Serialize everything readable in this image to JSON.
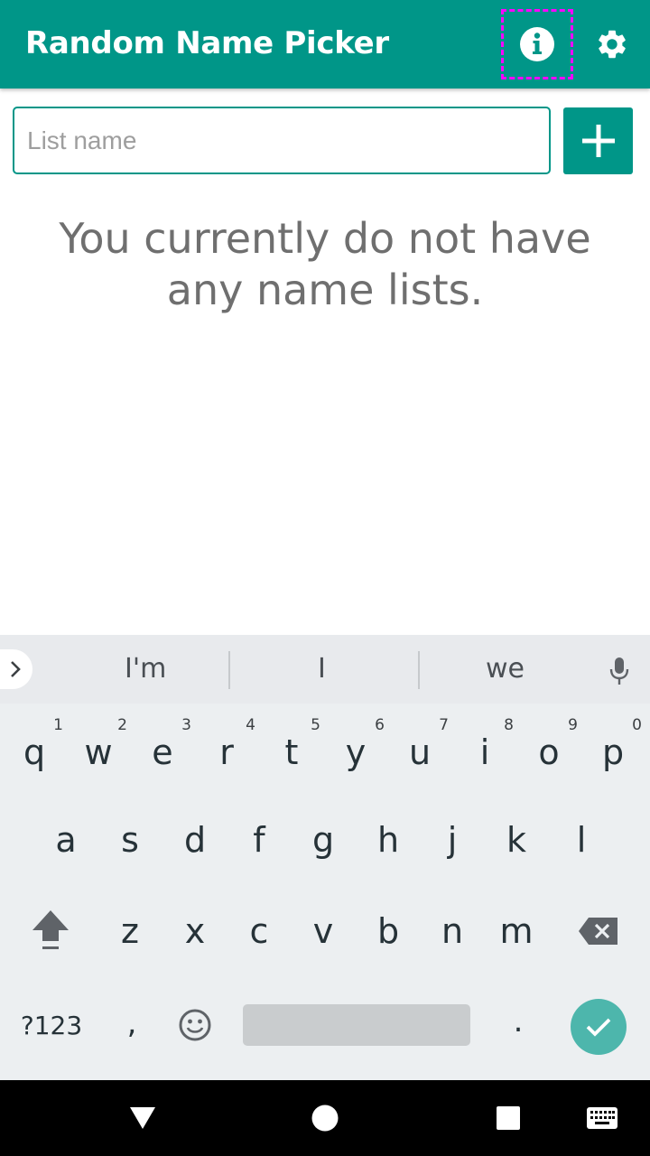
{
  "app": {
    "title": "Random Name Picker"
  },
  "toolbar": {
    "info_icon": "info-icon",
    "settings_icon": "gear-icon"
  },
  "form": {
    "list_name_value": "",
    "list_name_placeholder": "List name",
    "add_icon": "plus-icon"
  },
  "main": {
    "empty_message": "You currently do not have any name lists."
  },
  "keyboard": {
    "suggestions": [
      "I'm",
      "I",
      "we"
    ],
    "row1": [
      {
        "letter": "q",
        "number": "1"
      },
      {
        "letter": "w",
        "number": "2"
      },
      {
        "letter": "e",
        "number": "3"
      },
      {
        "letter": "r",
        "number": "4"
      },
      {
        "letter": "t",
        "number": "5"
      },
      {
        "letter": "y",
        "number": "6"
      },
      {
        "letter": "u",
        "number": "7"
      },
      {
        "letter": "i",
        "number": "8"
      },
      {
        "letter": "o",
        "number": "9"
      },
      {
        "letter": "p",
        "number": "0"
      }
    ],
    "row2": [
      "a",
      "s",
      "d",
      "f",
      "g",
      "h",
      "j",
      "k",
      "l"
    ],
    "row3": [
      "z",
      "x",
      "c",
      "v",
      "b",
      "n",
      "m"
    ],
    "symbols_label": "?123",
    "comma": ",",
    "period": ".",
    "emoji_icon": "smiley-icon",
    "shift_icon": "shift-icon",
    "backspace_icon": "backspace-icon",
    "enter_icon": "checkmark-icon",
    "mic_icon": "microphone-icon"
  },
  "colors": {
    "primary": "#009688",
    "accent": "#4db6ac",
    "highlight": "#ff00ff"
  }
}
